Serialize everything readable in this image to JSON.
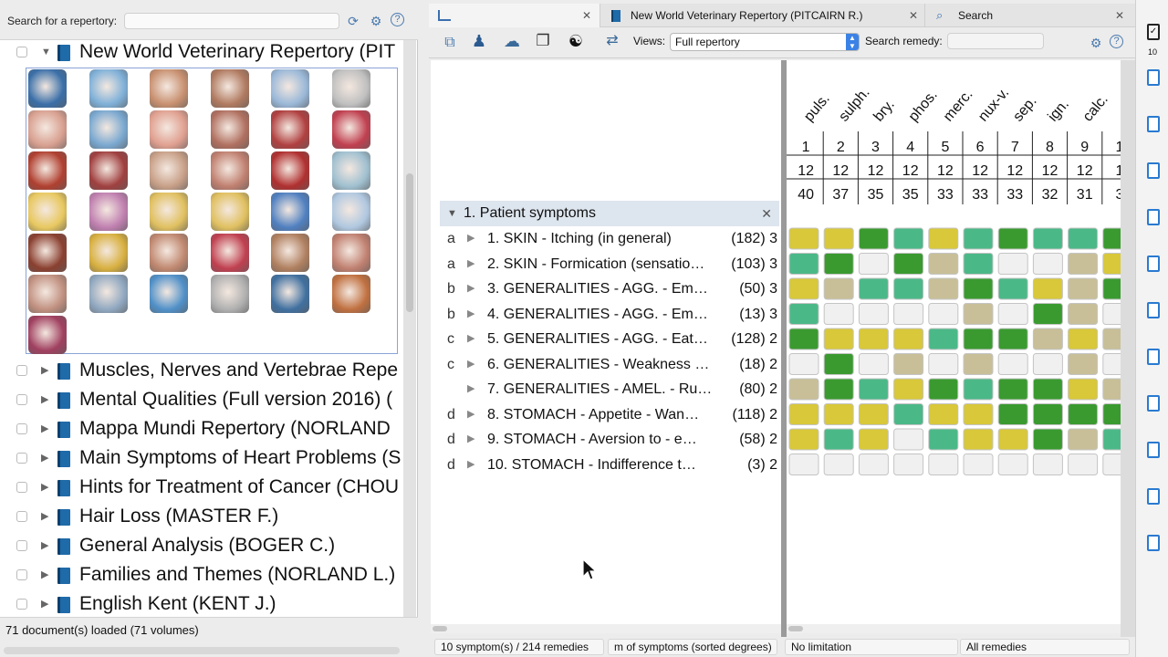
{
  "left": {
    "search_label": "Search for a repertory:",
    "status": "71 document(s) loaded (71 volumes)",
    "expanded_item": "New World Veterinary Repertory (PIT",
    "items": [
      "Muscles, Nerves and Vertebrae Repe",
      "Mental Qualities (Full version 2016) (",
      "Mappa Mundi Repertory (NORLAND",
      "Main Symptoms of Heart Problems (S",
      "Hints for Treatment of Cancer (CHOU",
      "Hair Loss (MASTER F.)",
      "General Analysis (BOGER C.)",
      "Families and Themes (NORLAND L.)",
      "English Kent (KENT J.)"
    ],
    "thumb_colors": [
      "#3a6fa8",
      "#7fb0d8",
      "#c89070",
      "#b07a60",
      "#9ab8d8",
      "#c0c0c0",
      "#d8a090",
      "#7aa8d0",
      "#e0a090",
      "#b07060",
      "#b04040",
      "#c04050",
      "#b04030",
      "#a04040",
      "#c8a088",
      "#c08070",
      "#b03030",
      "#a0c0d0",
      "#e8c860",
      "#c080b0",
      "#e0c060",
      "#e0c060",
      "#5080c0",
      "#b0c8e0",
      "#8a4030",
      "#d8b040",
      "#c08870",
      "#c04050",
      "#b08060",
      "#c08070",
      "#c09080",
      "#90a8c0",
      "#5090c8",
      "#b0b0b0",
      "#4070a0",
      "#c07040",
      "#a04060"
    ]
  },
  "right": {
    "tabs": [
      {
        "label": ""
      },
      {
        "label": "New World Veterinary Repertory (PITCAIRN R.)"
      },
      {
        "label": "Search"
      }
    ],
    "views_label": "Views:",
    "views_value": "Full repertory",
    "search_remedy_label": "Search remedy:",
    "section_title": "1. Patient symptoms",
    "symptoms": [
      {
        "letter": "a",
        "text": "1. SKIN - Itching (in general)",
        "count": "(182) 3"
      },
      {
        "letter": "a",
        "text": "2. SKIN - Formication (sensatio…",
        "count": "(103) 3"
      },
      {
        "letter": "b",
        "text": "3. GENERALITIES - AGG. - Em…",
        "count": "(50) 3"
      },
      {
        "letter": "b",
        "text": "4. GENERALITIES - AGG. - Em…",
        "count": "(13) 3"
      },
      {
        "letter": "c",
        "text": "5. GENERALITIES - AGG. - Eat…",
        "count": "(128) 2"
      },
      {
        "letter": "c",
        "text": "6. GENERALITIES - Weakness …",
        "count": "(18) 2"
      },
      {
        "letter": "",
        "text": "7. GENERALITIES - AMEL. - Ru…",
        "count": "(80) 2"
      },
      {
        "letter": "d",
        "text": "8. STOMACH - Appetite - Wan…",
        "count": "(118) 2"
      },
      {
        "letter": "d",
        "text": "9. STOMACH - Aversion to - e…",
        "count": "(58) 2"
      },
      {
        "letter": "d",
        "text": "10. STOMACH - Indifference t…",
        "count": "(3) 2"
      }
    ],
    "remedies": [
      "puls.",
      "sulph.",
      "bry.",
      "phos.",
      "merc.",
      "nux-v.",
      "sep.",
      "ign.",
      "calc.",
      ""
    ],
    "ranks": [
      "1",
      "2",
      "3",
      "4",
      "5",
      "6",
      "7",
      "8",
      "9",
      "1"
    ],
    "symptom_counts": [
      "12",
      "12",
      "12",
      "12",
      "12",
      "12",
      "12",
      "12",
      "12",
      "1"
    ],
    "scores": [
      "40",
      "37",
      "35",
      "35",
      "33",
      "33",
      "33",
      "32",
      "31",
      "3"
    ],
    "grid_colors": {
      "Y": "#d8c83a",
      "G": "#3a9a30",
      "T": "#4bb888",
      "B": "#c8bf98",
      "E": "#f0f0f0"
    },
    "grid": [
      [
        "Y",
        "Y",
        "G",
        "T",
        "Y",
        "T",
        "G",
        "T",
        "T",
        "G"
      ],
      [
        "T",
        "G",
        "E",
        "G",
        "B",
        "T",
        "E",
        "E",
        "B",
        "Y"
      ],
      [
        "Y",
        "B",
        "T",
        "T",
        "B",
        "G",
        "T",
        "Y",
        "B",
        "G"
      ],
      [
        "T",
        "E",
        "E",
        "E",
        "E",
        "B",
        "E",
        "G",
        "B",
        "E"
      ],
      [
        "G",
        "Y",
        "Y",
        "Y",
        "T",
        "G",
        "G",
        "B",
        "Y",
        "B"
      ],
      [
        "E",
        "G",
        "E",
        "B",
        "E",
        "B",
        "E",
        "E",
        "B",
        "E"
      ],
      [
        "B",
        "G",
        "T",
        "Y",
        "G",
        "T",
        "G",
        "G",
        "Y",
        "B"
      ],
      [
        "Y",
        "Y",
        "Y",
        "T",
        "Y",
        "Y",
        "G",
        "G",
        "G",
        "G"
      ],
      [
        "Y",
        "T",
        "Y",
        "E",
        "T",
        "Y",
        "Y",
        "G",
        "B",
        "T"
      ],
      [
        "E",
        "E",
        "E",
        "E",
        "E",
        "E",
        "E",
        "E",
        "E",
        "E"
      ]
    ],
    "status": {
      "symptoms": "10 symptom(s) / 214 remedies",
      "sort": "m of symptoms (sorted degrees)",
      "limit": "No limitation",
      "filter": "All remedies"
    }
  },
  "far_right": {
    "count": "10"
  }
}
